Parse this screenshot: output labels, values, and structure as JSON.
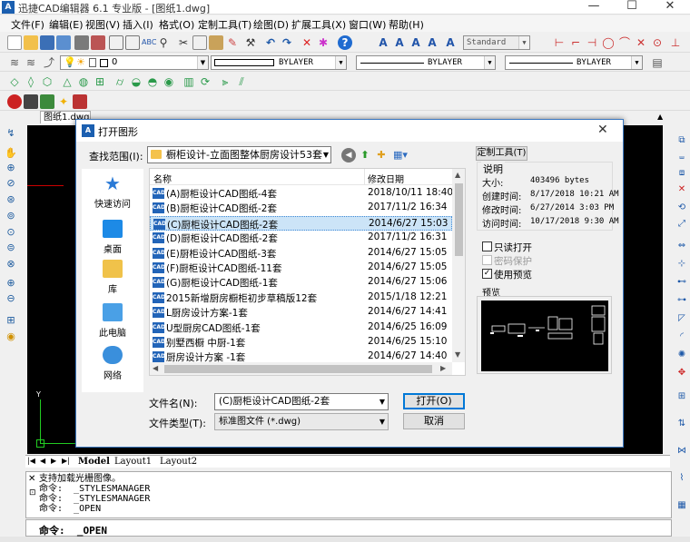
{
  "app": {
    "title": "迅捷CAD编辑器 6.1 专业版 - [图纸1.dwg]",
    "logo": "A",
    "window_controls": {
      "minimize": "—",
      "maximize": "☐",
      "close": "✕"
    }
  },
  "menu": [
    "文件(F)",
    "编辑(E)",
    "视图(V)",
    "插入(I)",
    "格式(O)",
    "定制工具(T)",
    "绘图(D)",
    "扩展工具(X)",
    "窗口(W)",
    "帮助(H)"
  ],
  "toolbar": {
    "text_style": "Standard",
    "layer": "0",
    "color": "BYLAYER",
    "linetype": "BYLAYER",
    "lineweight": "BYLAYER"
  },
  "doc_tab": "图纸1.dwg",
  "ucs": {
    "x": "X",
    "y": "Y"
  },
  "layout_tabs": [
    "Model",
    "Layout1",
    "Layout2"
  ],
  "command_history": [
    "支持加载光栅图像。",
    "命令:  _STYLESMANAGER",
    "命令:  _STYLESMANAGER",
    "命令:  _OPEN"
  ],
  "command_prompt": "命令:  _OPEN",
  "dialog": {
    "title": "打开图形",
    "icon": "A",
    "lookin_label": "查找范围(I):",
    "lookin_value": "橱柜设计-立面图整体厨房设计53套",
    "places": [
      {
        "label": "快速访问",
        "icon": "star-icon",
        "color": "#2a7ad6"
      },
      {
        "label": "桌面",
        "icon": "desktop-icon",
        "color": "#1d8ae6"
      },
      {
        "label": "库",
        "icon": "library-icon",
        "color": "#f0c24a"
      },
      {
        "label": "此电脑",
        "icon": "computer-icon",
        "color": "#4aa0e6"
      },
      {
        "label": "网络",
        "icon": "network-icon",
        "color": "#3a8fdc"
      }
    ],
    "columns": {
      "name": "名称",
      "date": "修改日期"
    },
    "files": [
      {
        "name": "(A)厨柜设计CAD图纸-4套",
        "date": "2018/10/11 18:40",
        "icon": "CAD"
      },
      {
        "name": "(B)厨柜设计CAD图纸-2套",
        "date": "2017/11/2 16:34",
        "icon": "CAD"
      },
      {
        "name": "(C)厨柜设计CAD图纸-2套",
        "date": "2014/6/27 15:03",
        "icon": "CAD"
      },
      {
        "name": "(D)厨柜设计CAD图纸-2套",
        "date": "2017/11/2 16:31",
        "icon": "CAD"
      },
      {
        "name": "(E)厨柜设计CAD图纸-3套",
        "date": "2014/6/27 15:05",
        "icon": "CAD"
      },
      {
        "name": "(F)厨柜设计CAD图纸-11套",
        "date": "2014/6/27 15:05",
        "icon": "CAD"
      },
      {
        "name": "(G)厨柜设计CAD图纸-1套",
        "date": "2014/6/27 15:06",
        "icon": "CAD"
      },
      {
        "name": "2015新增厨房橱柜初步草稿版12套",
        "date": "2015/1/18 12:21",
        "icon": "CAD"
      },
      {
        "name": "L厨房设计方案-1套",
        "date": "2014/6/27 14:41",
        "icon": "CAD"
      },
      {
        "name": "U型厨房CAD图纸-1套",
        "date": "2014/6/25 16:09",
        "icon": "CAD"
      },
      {
        "name": "别墅西橱 中厨-1套",
        "date": "2014/6/25 15:10",
        "icon": "CAD"
      },
      {
        "name": "厨房设计方案 -1套",
        "date": "2014/6/27 14:40",
        "icon": "CAD"
      },
      {
        "name": "厨房设计方案 -3套",
        "date": "2014/6/27 14:32",
        "icon": "CAD"
      }
    ],
    "selected_index": 2,
    "filename_label": "文件名(N):",
    "filename_value": "(C)厨柜设计CAD图纸-2套",
    "filetype_label": "文件类型(T):",
    "filetype_value": "标准图文件 (*.dwg)",
    "open_button": "打开(O)",
    "cancel_button": "取消",
    "custom_button": "定制工具(T)",
    "desc_title": "说明",
    "info": [
      {
        "label": "大小:",
        "value": "403496 bytes"
      },
      {
        "label": "创建时间:",
        "value": "8/17/2018 10:21 AM"
      },
      {
        "label": "修改时间:",
        "value": "6/27/2014 3:03 PM"
      },
      {
        "label": "访问时间:",
        "value": "10/17/2018 9:30 AM"
      }
    ],
    "readonly_label": "只读打开",
    "password_label": "密码保护",
    "preview_check_label": "使用预览",
    "preview_checked": true,
    "preview_title": "预览"
  }
}
